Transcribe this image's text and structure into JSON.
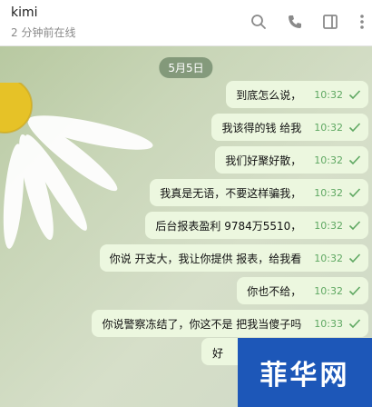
{
  "header": {
    "contact_name": "kimi",
    "status": "2 分钟前在线"
  },
  "chat": {
    "date_label": "5月5日",
    "messages": [
      {
        "text": "到底怎么说，",
        "time": "10:32"
      },
      {
        "text": "我该得的钱 给我",
        "time": "10:32"
      },
      {
        "text": "我们好聚好散，",
        "time": "10:32"
      },
      {
        "text": "我真是无语，不要这样骗我，",
        "time": "10:32"
      },
      {
        "text": "后台报表盈利 9784万5510，",
        "time": "10:32"
      },
      {
        "text": "你说 开支大，我让你提供 报表，给我看",
        "time": "10:32"
      },
      {
        "text": "你也不给，",
        "time": "10:32"
      },
      {
        "text": "你说警察冻结了，你这不是 把我当傻子吗",
        "time": "10:33"
      },
      {
        "text": "好",
        "time": ""
      }
    ]
  },
  "watermark": {
    "text": "菲华网"
  },
  "colors": {
    "check": "#5fa862",
    "bubble": "#ecf7df"
  }
}
